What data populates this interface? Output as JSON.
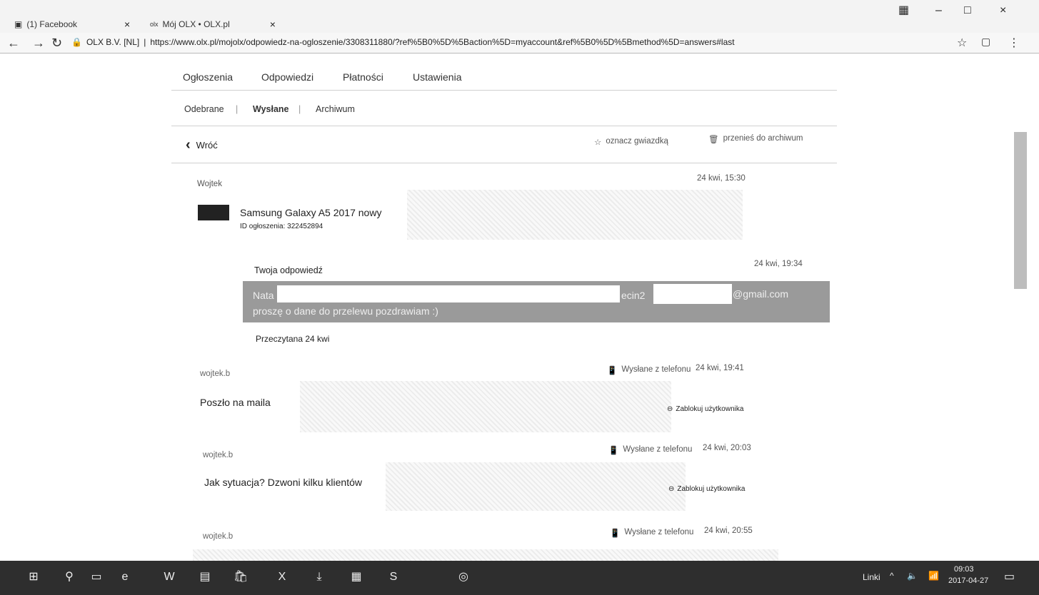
{
  "browser": {
    "tabs": [
      {
        "label": "(1) Facebook",
        "close": "×"
      },
      {
        "label": "Mój OLX • OLX.pl",
        "close": "×"
      }
    ],
    "window_controls": [
      "–",
      "□",
      "×"
    ],
    "secure_label": "OLX B.V. [NL]",
    "url": "https://www.olx.pl/mojolx/odpowiedz-na-ogloszenie/3308311880/?ref%5B0%5D%5Baction%5D=myaccount&ref%5B0%5D%5Bmethod%5D=answers#last"
  },
  "main_tabs": [
    "Ogłoszenia",
    "Odpowiedzi",
    "Płatności",
    "Ustawienia"
  ],
  "sub_tabs": [
    "Odebrane",
    "Wysłane",
    "Archiwum"
  ],
  "actions": {
    "back": "Wróć",
    "star": "oznacz gwiazdką",
    "archive": "przenieś do archiwum"
  },
  "thread": {
    "sender": "Wojtek",
    "date": "24 kwi, 15:30",
    "ad_title": "Samsung Galaxy A5 2017 nowy",
    "ad_id": "ID ogłoszenia: 322452894"
  },
  "reply": {
    "label": "Twoja odpowiedź",
    "date": "24 kwi, 19:34",
    "line1_start": "Nata",
    "line1_mid": "ecin2",
    "line1_end": "@gmail.com",
    "line2": "proszę o dane do przelewu pozdrawiam :)",
    "read_status": "Przeczytana 24 kwi"
  },
  "messages": [
    {
      "sender": "wojtek.b",
      "source": "Wysłane z telefonu",
      "date": "24 kwi, 19:41",
      "text": "Poszło na maila",
      "block": "Zablokuj użytkownika"
    },
    {
      "sender": "wojtek.b",
      "source": "Wysłane z telefonu",
      "date": "24 kwi, 20:03",
      "text": "Jak sytuacja? Dzwoni kilku klientów",
      "block": "Zablokuj użytkownika"
    },
    {
      "sender": "wojtek.b",
      "source": "Wysłane z telefonu",
      "date": "24 kwi, 20:55"
    }
  ],
  "taskbar": {
    "links": "Linki",
    "time": "09:03",
    "date": "2017-04-27"
  },
  "colors": {
    "taskbar": "#2e2e2e",
    "reply_bg": "#9a9a9a"
  }
}
